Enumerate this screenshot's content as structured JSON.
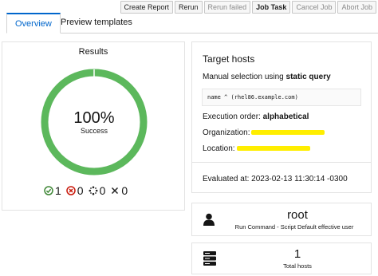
{
  "toolbar": {
    "create_report": "Create Report",
    "rerun": "Rerun",
    "rerun_failed": "Rerun failed",
    "job_task": "Job Task",
    "cancel_job": "Cancel Job",
    "abort_job": "Abort Job"
  },
  "tabs": {
    "overview": "Overview",
    "preview": "Preview templates"
  },
  "results": {
    "title": "Results",
    "percent": "100%",
    "percent_label": "Success",
    "progress": 1.0,
    "success_color": "#5cb85c",
    "stats": {
      "succeeded": "1",
      "failed": "0",
      "pending": "0",
      "cancelled": "0"
    }
  },
  "target_hosts": {
    "title": "Target hosts",
    "selection_prefix": "Manual selection using ",
    "selection_bold": "static query",
    "query": "name ^ (rhel86.example.com)",
    "execution_order_label": "Execution order: ",
    "execution_order_value": "alphabetical",
    "organization_label": "Organization:",
    "location_label": "Location:",
    "evaluated_label": "Evaluated at: ",
    "evaluated_value": "2023-02-13 11:30:14 -0300"
  },
  "effective_user": {
    "name": "root",
    "description": "Run Command - Script Default effective user"
  },
  "total_hosts": {
    "count": "1",
    "label": "Total hosts"
  }
}
